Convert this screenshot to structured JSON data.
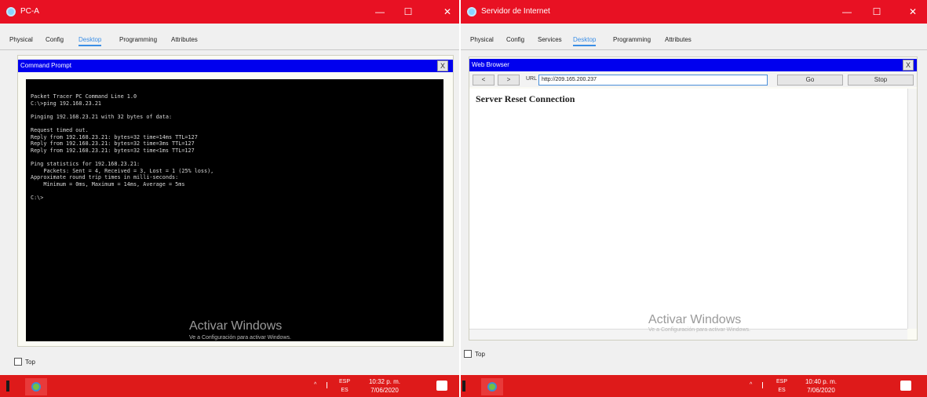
{
  "pc_window": {
    "title": "PC-A",
    "controls": {
      "minimize": "—",
      "maximize": "☐",
      "close": "✕"
    },
    "tabs": [
      "Physical",
      "Config",
      "Desktop",
      "Programming",
      "Attributes"
    ],
    "active_tab": "Desktop",
    "command_prompt": {
      "title": "Command Prompt",
      "close_label": "X",
      "lines": [
        "Packet Tracer PC Command Line 1.0",
        "C:\\>ping 192.168.23.21",
        "",
        "Pinging 192.168.23.21 with 32 bytes of data:",
        "",
        "Request timed out.",
        "Reply from 192.168.23.21: bytes=32 time=14ms TTL=127",
        "Reply from 192.168.23.21: bytes=32 time=3ms TTL=127",
        "Reply from 192.168.23.21: bytes=32 time<1ms TTL=127",
        "",
        "Ping statistics for 192.168.23.21:",
        "    Packets: Sent = 4, Received = 3, Lost = 1 (25% loss),",
        "Approximate round trip times in milli-seconds:",
        "    Minimum = 0ms, Maximum = 14ms, Average = 5ms",
        "",
        "C:\\>"
      ]
    },
    "watermark": {
      "title": "Activar Windows",
      "subtitle": "Ve a Configuración para activar Windows."
    },
    "top_checkbox_label": "Top",
    "taskbar": {
      "lang_top": "ESP",
      "lang_bottom": "ES",
      "time": "10:32 p. m.",
      "date": "7/06/2020",
      "tray_arrow": "^"
    }
  },
  "server_window": {
    "title": "Servidor de Internet",
    "controls": {
      "minimize": "—",
      "maximize": "☐",
      "close": "✕"
    },
    "tabs": [
      "Physical",
      "Config",
      "Services",
      "Desktop",
      "Programming",
      "Attributes"
    ],
    "active_tab": "Desktop",
    "browser": {
      "title": "Web Browser",
      "close_label": "X",
      "back_label": "<",
      "forward_label": ">",
      "url_label": "URL",
      "url_value": "http://209.165.200.237",
      "go_label": "Go",
      "stop_label": "Stop",
      "page_message": "Server Reset Connection"
    },
    "watermark": {
      "title": "Activar Windows",
      "subtitle": "Ve a Configuración para activar Windows."
    },
    "top_checkbox_label": "Top",
    "taskbar": {
      "lang_top": "ESP",
      "lang_bottom": "ES",
      "time": "10:40 p. m.",
      "date": "7/06/2020",
      "tray_arrow": "^"
    }
  },
  "colors": {
    "titlebar": "#e81123",
    "taskbar": "#de1a1a",
    "active_tab": "#3a8ee6",
    "panel_header": "#0000ee",
    "terminal_bg": "#000000"
  }
}
